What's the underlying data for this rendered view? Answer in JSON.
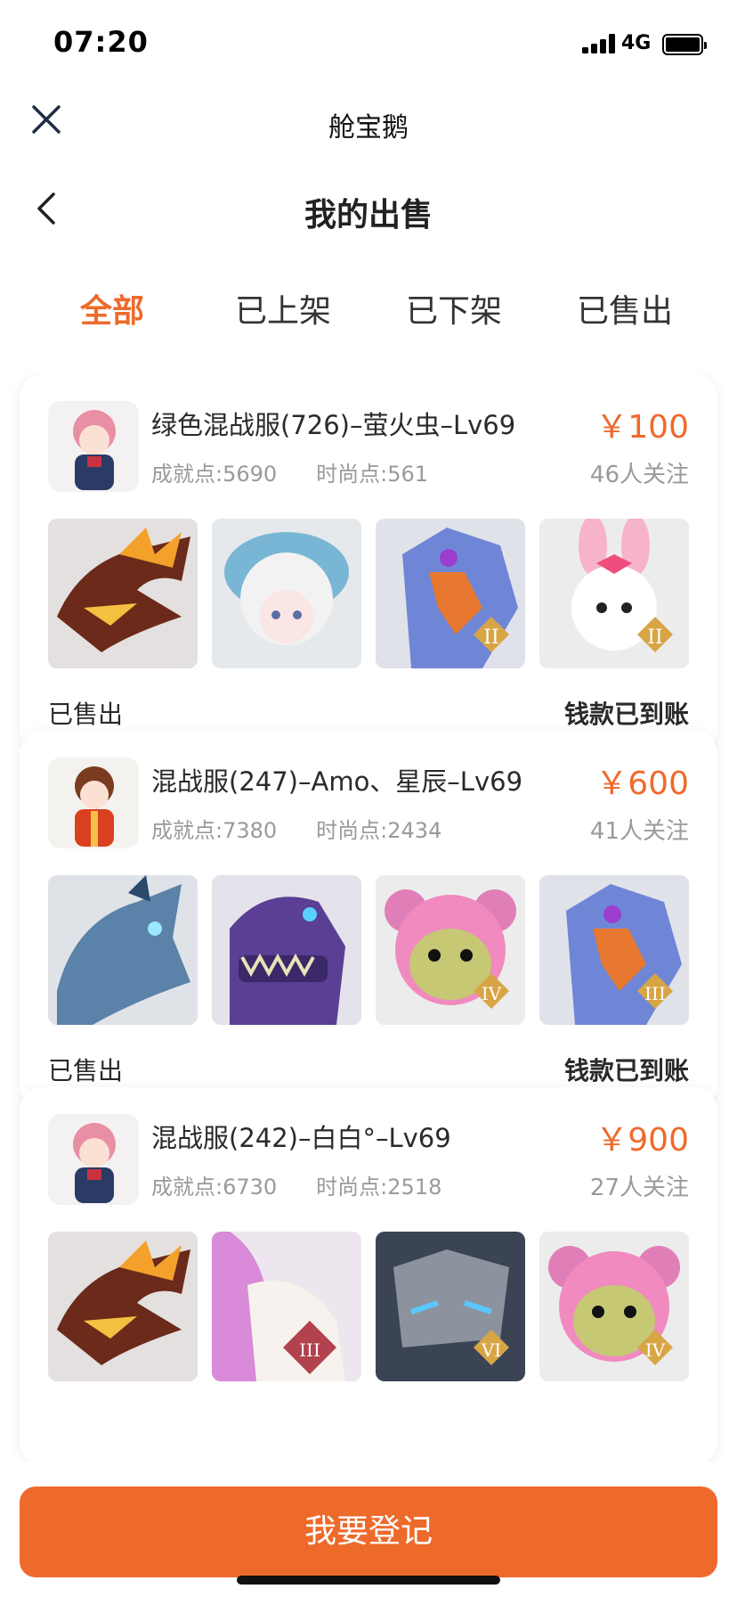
{
  "status_bar": {
    "time": "07:20",
    "network": "4G"
  },
  "app_bar": {
    "title": "舱宝鹅",
    "close_icon": "close-icon"
  },
  "nav_bar": {
    "title": "我的出售",
    "back_icon": "back-chevron-icon"
  },
  "tabs": [
    {
      "label": "全部",
      "active": true
    },
    {
      "label": "已上架",
      "active": false
    },
    {
      "label": "已下架",
      "active": false
    },
    {
      "label": "已售出",
      "active": false
    }
  ],
  "listings": [
    {
      "title": "绿色混战服(726)–萤火虫–Lv69",
      "achievement": "成就点:5690",
      "fashion": "时尚点:561",
      "price": "￥100",
      "followers": "46人关注",
      "status": "已售出",
      "payment": "钱款已到账",
      "avatar": "pink-hair-character-avatar",
      "items": [
        {
          "name": "fire-dragon-pet",
          "badge": ""
        },
        {
          "name": "white-sheep-pet",
          "badge": ""
        },
        {
          "name": "blue-eagle-pet",
          "badge": "II"
        },
        {
          "name": "pink-bunny-pet",
          "badge": "II"
        }
      ]
    },
    {
      "title": "混战服(247)–Amo、星辰–Lv69",
      "achievement": "成就点:7380",
      "fashion": "时尚点:2434",
      "price": "￥600",
      "followers": "41人关注",
      "status": "已售出",
      "payment": "钱款已到账",
      "avatar": "brown-hair-boy-avatar",
      "items": [
        {
          "name": "ice-dragon-pet",
          "badge": ""
        },
        {
          "name": "purple-dinosaur-pet",
          "badge": ""
        },
        {
          "name": "pink-bear-pet",
          "badge": "IV"
        },
        {
          "name": "blue-eagle-pet",
          "badge": "III"
        }
      ]
    },
    {
      "title": "混战服(242)–白白°–Lv69",
      "achievement": "成就点:6730",
      "fashion": "时尚点:2518",
      "price": "￥900",
      "followers": "27人关注",
      "status": "",
      "payment": "",
      "avatar": "pink-hair-character-avatar",
      "items": [
        {
          "name": "fire-dragon-pet",
          "badge": ""
        },
        {
          "name": "white-unicorn-pet",
          "badge": "III"
        },
        {
          "name": "stone-golem-pet",
          "badge": "VI"
        },
        {
          "name": "pink-bear-pet",
          "badge": "IV"
        }
      ]
    }
  ],
  "cta": {
    "label": "我要登记"
  }
}
